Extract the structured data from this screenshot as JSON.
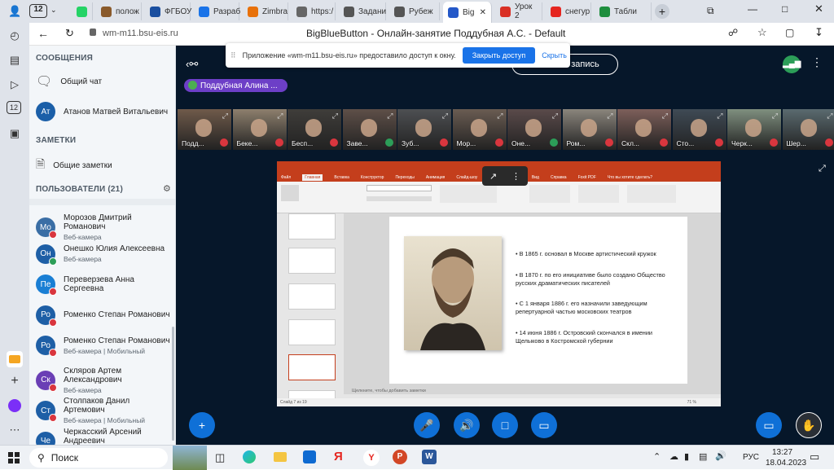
{
  "browser": {
    "tab_count": "12",
    "tabs": [
      {
        "label": "",
        "color": "#25d366"
      },
      {
        "label": "полож",
        "color": "#8a5a2b"
      },
      {
        "label": "ФГБОУ",
        "color": "#1a4fa0"
      },
      {
        "label": "Разраб",
        "color": "#1a73e8"
      },
      {
        "label": "Zimbra",
        "color": "#e8710a"
      },
      {
        "label": "https:/",
        "color": "#666666"
      },
      {
        "label": "Задани",
        "color": "#555555"
      },
      {
        "label": "Рубеж",
        "color": "#555555"
      },
      {
        "label": "Big",
        "color": "#2458c8"
      },
      {
        "label": "Урок 2",
        "color": "#d93025"
      },
      {
        "label": "снегур",
        "color": "#e52620"
      },
      {
        "label": "Табли",
        "color": "#1e8e3e"
      }
    ],
    "url": "wm-m11.bsu-eis.ru",
    "page_title": "BigBlueButton - Онлайн-занятие Поддубная А.С. - Default"
  },
  "banner": {
    "text": "Приложение «wm-m11.bsu-eis.ru» предоставило доступ к окну.",
    "stop_label": "Закрыть доступ",
    "hide_label": "Скрыть"
  },
  "side": {
    "messages_heading": "СООБЩЕНИЯ",
    "public_chat": "Общий чат",
    "private_chat_user": {
      "initials": "Ат",
      "name": "Атанов Матвей Витальевич",
      "color": "#1b5fa8"
    },
    "notes_heading": "ЗАМЕТКИ",
    "shared_notes": "Общие заметки",
    "users_heading": "ПОЛЬЗОВАТЕЛИ (21)",
    "users": [
      {
        "initials": "Мо",
        "name": "Морозов Дмитрий Романович",
        "sub": "Веб-камера",
        "color": "#3a6ea5"
      },
      {
        "initials": "Он",
        "name": "Онешко Юлия Алексеевна",
        "sub": "Веб-камера",
        "color": "#1e5fa6"
      },
      {
        "initials": "Пе",
        "name": "Переверзева Анна Сергеевна",
        "sub": "",
        "color": "#1a7fd4"
      },
      {
        "initials": "Ро",
        "name": "Роменко Степан Романович",
        "sub": "",
        "color": "#1e5fa6"
      },
      {
        "initials": "Ро",
        "name": "Роменко Степан Романович",
        "sub": "Веб-камера | Мобильный",
        "color": "#1e5fa6"
      },
      {
        "initials": "Ск",
        "name": "Скляров Артем Александрович",
        "sub": "Веб-камера",
        "color": "#6a3fb5"
      },
      {
        "initials": "Ст",
        "name": "Столпаков Данил Артемович",
        "sub": "Веб-камера | Мобильный",
        "color": "#1e5fa6"
      },
      {
        "initials": "Че",
        "name": "Черкасский Арсений Андреевич",
        "sub": "Веб-камера",
        "color": "#1e5fa6"
      }
    ]
  },
  "header": {
    "talking": "Поддубная Алина ...",
    "recording": "ить запись"
  },
  "cameras": [
    "Подд...",
    "Беке...",
    "Бесп...",
    "Заве...",
    "Зуб...",
    "Мор...",
    "Оне...",
    "Ром...",
    "Скл...",
    "Сто...",
    "Черк...",
    "Шер..."
  ],
  "presentation": {
    "tabs": [
      "Файл",
      "Главная",
      "Вставка",
      "Конструктор",
      "Переходы",
      "Анимация",
      "Слайд-шоу",
      "Рецензирование",
      "Вид",
      "Справка",
      "Foxit PDF",
      "Что вы хотите сделать?"
    ],
    "bullets": [
      "В 1865 г. основал в Москве артистический кружок",
      "В 1870 г. по его инициативе было создано Общество русских драматических писателей",
      "С 1 января 1886 г. его назначили заведующим репертуарной частью московских театров",
      "14 июня 1886 г. Островский скончался в имении Щелыково в Костромской губернии"
    ],
    "notes_placeholder": "Щелкните, чтобы добавить заметки",
    "status": "Слайд 7 из 19",
    "zoom": "71 %"
  },
  "taskbar": {
    "search_placeholder": "Поиск",
    "lang": "РУС",
    "time": "13:27",
    "date": "18.04.2023"
  }
}
